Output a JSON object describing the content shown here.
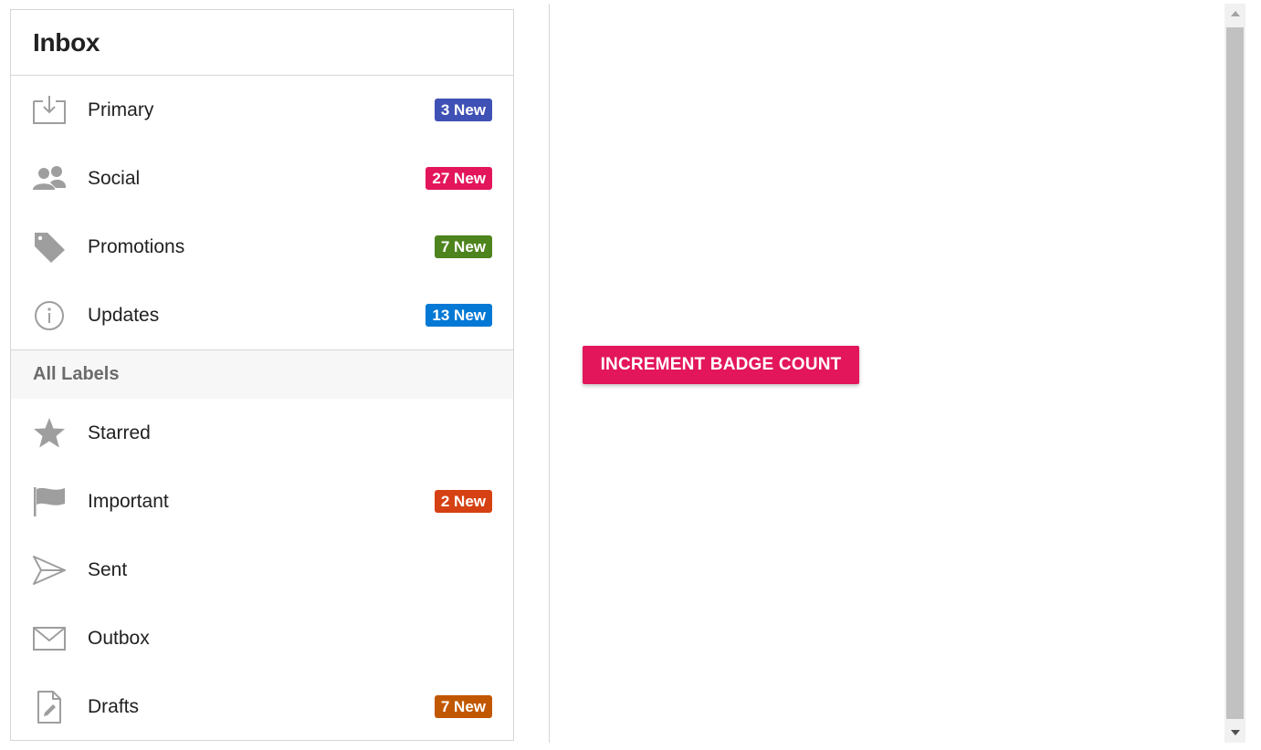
{
  "panel": {
    "title": "Inbox",
    "inbox_items": [
      {
        "label": "Primary",
        "icon": "inbox-download-icon",
        "badge": "3 New",
        "badge_color": "#3f51b5"
      },
      {
        "label": "Social",
        "icon": "people-icon",
        "badge": "27 New",
        "badge_color": "#e3165b"
      },
      {
        "label": "Promotions",
        "icon": "tag-icon",
        "badge": "7 New",
        "badge_color": "#4d841d"
      },
      {
        "label": "Updates",
        "icon": "info-icon",
        "badge": "13 New",
        "badge_color": "#0378d5"
      }
    ],
    "labels_header": "All Labels",
    "label_items": [
      {
        "label": "Starred",
        "icon": "star-icon"
      },
      {
        "label": "Important",
        "icon": "flag-icon",
        "badge": "2 New",
        "badge_color": "#d64113"
      },
      {
        "label": "Sent",
        "icon": "send-icon"
      },
      {
        "label": "Outbox",
        "icon": "envelope-icon"
      },
      {
        "label": "Drafts",
        "icon": "draft-file-icon",
        "badge": "7 New",
        "badge_color": "#c15700"
      }
    ]
  },
  "action_button": {
    "label": "INCREMENT BADGE COUNT",
    "color": "#e3165b"
  },
  "icon_color": "#9e9e9e"
}
